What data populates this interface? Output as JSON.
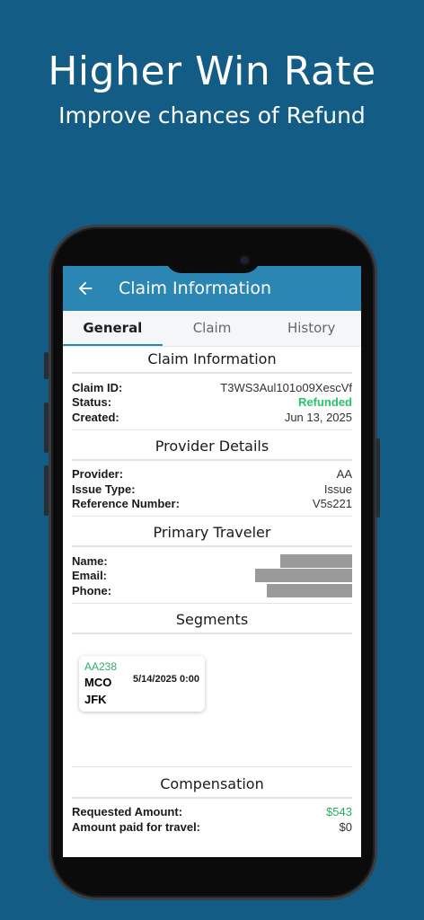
{
  "hero": {
    "title": "Higher Win Rate",
    "subtitle": "Improve chances of Refund"
  },
  "appbar": {
    "back_icon": "arrow-left-icon",
    "title": "Claim Information"
  },
  "tabs": [
    {
      "label": "General",
      "active": true
    },
    {
      "label": "Claim",
      "active": false
    },
    {
      "label": "History",
      "active": false
    }
  ],
  "claim_info": {
    "title": "Claim Information",
    "rows": [
      {
        "label": "Claim ID:",
        "value": "T3WS3Aul101o09XescVf"
      },
      {
        "label": "Status:",
        "value": "Refunded"
      },
      {
        "label": "Created:",
        "value": "Jun 13, 2025"
      }
    ]
  },
  "provider": {
    "title": "Provider Details",
    "rows": [
      {
        "label": "Provider:",
        "value": "AA"
      },
      {
        "label": "Issue Type:",
        "value": "Issue"
      },
      {
        "label": "Reference Number:",
        "value": "V5s221"
      }
    ]
  },
  "traveler": {
    "title": "Primary Traveler",
    "rows": [
      {
        "label": "Name:"
      },
      {
        "label": "Email:"
      },
      {
        "label": "Phone:"
      }
    ]
  },
  "segments": {
    "title": "Segments",
    "items": [
      {
        "flight": "AA238",
        "origin": "MCO",
        "destination": "JFK",
        "date": "5/14/2025 0:00"
      }
    ]
  },
  "compensation": {
    "title": "Compensation",
    "rows": [
      {
        "label": "Requested Amount:",
        "value": "$543"
      },
      {
        "label": "Amount paid for travel:",
        "value": "$0"
      }
    ]
  },
  "colors": {
    "background": "#135c86",
    "appbar": "#2b86b3",
    "status_green": "#27c46a"
  }
}
